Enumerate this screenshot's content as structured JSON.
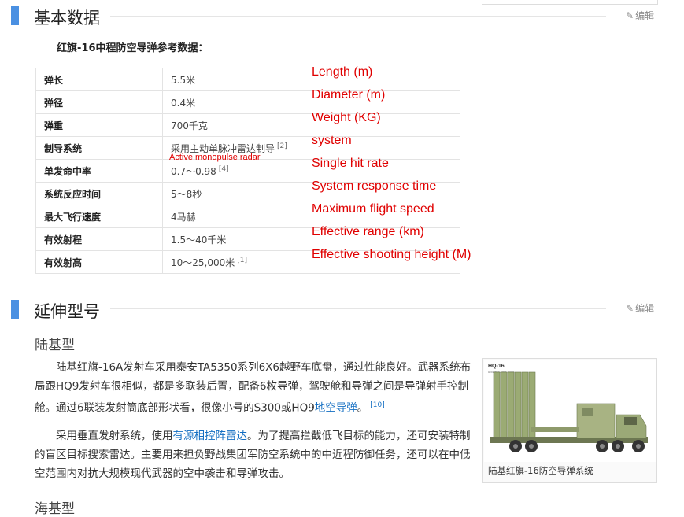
{
  "section1": {
    "title": "基本数据",
    "edit": "编辑"
  },
  "table": {
    "title": "红旗-16中程防空导弹参考数据：",
    "rows": [
      {
        "key": "弹长",
        "value": "5.5米",
        "ref": "",
        "note": "Length (m)"
      },
      {
        "key": "弹径",
        "value": "0.4米",
        "ref": "",
        "note": "Diameter (m)"
      },
      {
        "key": "弹重",
        "value": "700千克",
        "ref": "",
        "note": "Weight (KG)"
      },
      {
        "key": "制导系统",
        "value": "采用主动单脉冲雷达制导",
        "ref": "[2]",
        "note": "system"
      },
      {
        "key": "单发命中率",
        "value": "0.7～0.98",
        "ref": "[4]",
        "note": "Single hit rate"
      },
      {
        "key": "系统反应时间",
        "value": "5～8秒",
        "ref": "",
        "note": "System response time"
      },
      {
        "key": "最大飞行速度",
        "value": "4马赫",
        "ref": "",
        "note": "Maximum flight speed"
      },
      {
        "key": "有效射程",
        "value": "1.5～40千米",
        "ref": "",
        "note": "Effective range (km)"
      },
      {
        "key": "有效射高",
        "value": "10～25,000米",
        "ref": "[1]",
        "note": "Effective shooting height (M)"
      }
    ],
    "guidance_note": "Active monopulse radar"
  },
  "section2": {
    "title": "延伸型号",
    "edit": "编辑"
  },
  "land": {
    "title": "陆基型",
    "p1_text": "陆基红旗-16A发射车采用泰安TA5350系列6X6越野车底盘，通过性能良好。武器系统布局跟HQ9发射车很相似，都是多联装后置，配备6枚导弹，驾驶舱和导弹之间是导弹射手控制舱。通过6联装发射筒底部形状看，很像小号的S300或HQ9",
    "p1_link": "地空导弹",
    "p1_end": "。",
    "p1_ref": "[10]",
    "p2_a": "采用垂直发射系统，使用",
    "p2_link": "有源相控阵雷达",
    "p2_b": "。为了提高拦截低飞目标的能力，还可安装特制的盲区目标搜索雷达。主要用来担负野战集团军防空系统中的中近程防御任务，还可以在中低空范围内对抗大规模现代武器的空中袭击和导弹攻击。",
    "figure_caption": "陆基红旗-16防空导弹系统",
    "figure_label": "HQ-16",
    "figure_sublabel": "updated April 2008"
  },
  "sea": {
    "title": "海基型"
  },
  "colors": {
    "accent": "#4a90e2",
    "link": "#136ec2",
    "annotation": "#e00000"
  }
}
